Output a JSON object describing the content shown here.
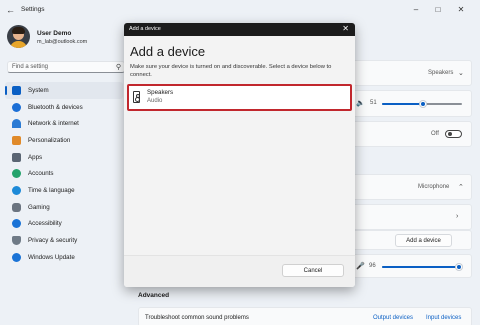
{
  "window": {
    "title": "Settings"
  },
  "user": {
    "name": "User Demo",
    "email": "m_lab@outlook.com"
  },
  "search": {
    "placeholder": "Find a setting"
  },
  "sidebar": {
    "items": [
      {
        "label": "System",
        "icon": "system-icon",
        "color": "#0a5fc4",
        "active": true
      },
      {
        "label": "Bluetooth & devices",
        "icon": "bluetooth-icon",
        "color": "#1c6fd6"
      },
      {
        "label": "Network & internet",
        "icon": "wifi-icon",
        "color": "#2b7bd4"
      },
      {
        "label": "Personalization",
        "icon": "brush-icon",
        "color": "#e08a2a"
      },
      {
        "label": "Apps",
        "icon": "apps-icon",
        "color": "#5a6573"
      },
      {
        "label": "Accounts",
        "icon": "accounts-icon",
        "color": "#24a36c"
      },
      {
        "label": "Time & language",
        "icon": "globe-icon",
        "color": "#1d8ad8"
      },
      {
        "label": "Gaming",
        "icon": "gaming-icon",
        "color": "#6b7480"
      },
      {
        "label": "Accessibility",
        "icon": "accessibility-icon",
        "color": "#1a73d6"
      },
      {
        "label": "Privacy & security",
        "icon": "shield-icon",
        "color": "#6f7a86"
      },
      {
        "label": "Windows Update",
        "icon": "update-icon",
        "color": "#1a73d6"
      }
    ]
  },
  "main": {
    "output_device_value": "Speakers",
    "volume_value": "51",
    "volume_level": 0.51,
    "mono_audio_state": "Off",
    "input_device_value": "Microphone",
    "add_device_label": "Add a device",
    "input_volume_value": "96",
    "input_volume_level": 0.96,
    "advanced_heading": "Advanced",
    "troubleshoot_label": "Troubleshoot common sound problems",
    "output_devices_link": "Output devices",
    "input_devices_link": "Input devices"
  },
  "dialog": {
    "titlebar": "Add a device",
    "heading": "Add a device",
    "description": "Make sure your device is turned on and discoverable. Select a device below to connect.",
    "device": {
      "name": "Speakers",
      "type": "Audio",
      "icon": "speaker-icon",
      "highlight_color": "#c1272d"
    },
    "cancel_label": "Cancel"
  },
  "colors": {
    "accent": "#0a5fc4"
  }
}
